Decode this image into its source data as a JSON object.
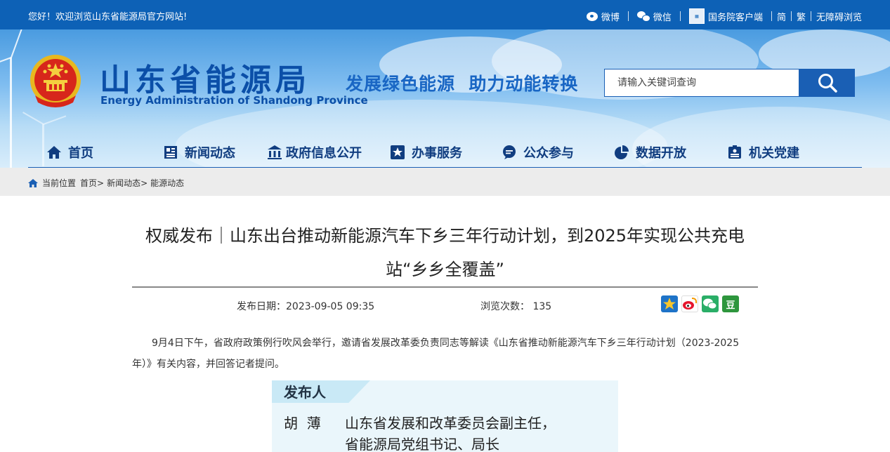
{
  "topbar": {
    "welcome": "您好！欢迎浏览山东省能源局官方网站!",
    "weibo": "微博",
    "wechat": "微信",
    "gov_client": "国务院客户端",
    "simplified": "简",
    "traditional": "繁",
    "accessible": "无障碍浏览"
  },
  "header": {
    "title": "山东省能源局",
    "title_en": "Energy Administration of Shandong Province",
    "slogan": "发展绿色能源  助力动能转换"
  },
  "search": {
    "placeholder": "请输入关键词查询"
  },
  "nav": [
    {
      "label": "首页",
      "icon": "home-icon"
    },
    {
      "label": "新闻动态",
      "icon": "news-icon"
    },
    {
      "label": "政府信息公开",
      "icon": "government-icon"
    },
    {
      "label": "办事服务",
      "icon": "star-icon"
    },
    {
      "label": "公众参与",
      "icon": "chat-icon"
    },
    {
      "label": "数据开放",
      "icon": "pie-chart-icon"
    },
    {
      "label": "机关党建",
      "icon": "badge-icon"
    }
  ],
  "breadcrumb": {
    "prefix": "当前位置",
    "home": "首页>",
    "news": "新闻动态>",
    "current": "能源动态"
  },
  "article": {
    "title": "权威发布｜山东出台推动新能源汽车下乡三年行动计划，到2025年实现公共充电站“乡乡全覆盖”",
    "publish_date": "发布日期：2023-09-05 09:35",
    "views": "浏览次数：  135",
    "paragraph": "9月4日下午，省政府政策例行吹风会举行，邀请省发展改革委负责同志等解读《山东省推动新能源汽车下乡三年行动计划（2023-2025年）》有关内容，并回答记者提问。",
    "share": [
      "收藏",
      "新浪微博",
      "微信",
      "豆瓣"
    ],
    "share_douban_glyph": "豆"
  },
  "picture": {
    "tab": "发布人",
    "name": "胡  薄",
    "role_line1": "山东省发展和改革委员会副主任，",
    "role_line2": "省能源局党组书记、局长"
  }
}
